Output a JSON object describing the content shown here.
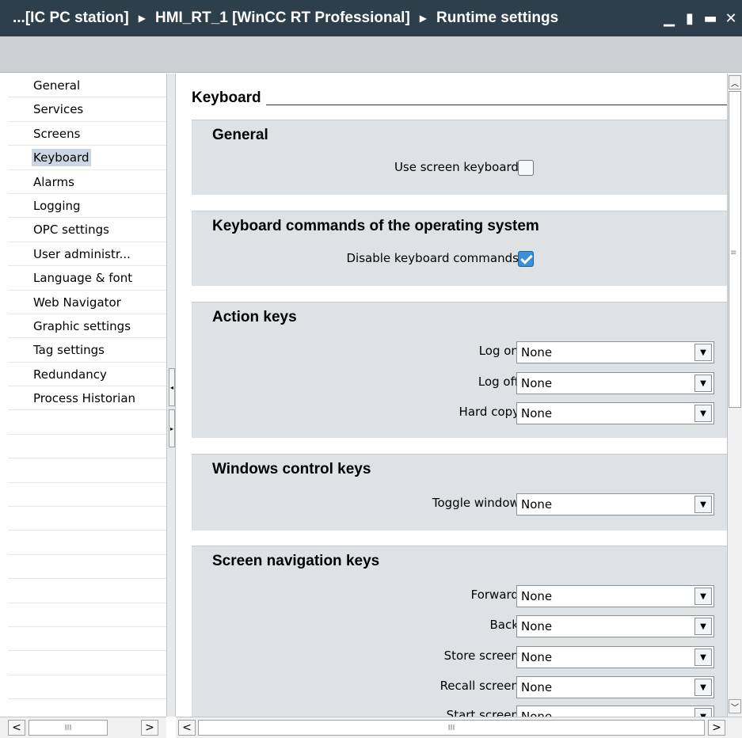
{
  "title_bar": {
    "crumbs": [
      "...[IC PC station]",
      "HMI_RT_1 [WinCC RT Professional]",
      "Runtime settings"
    ],
    "separator": "▶",
    "controls": {
      "minimize": "▁",
      "restore": "▮",
      "maximize": "▬",
      "close": "✕"
    }
  },
  "nav": {
    "items": [
      {
        "label": "General"
      },
      {
        "label": "Services"
      },
      {
        "label": "Screens"
      },
      {
        "label": "Keyboard",
        "selected": true
      },
      {
        "label": "Alarms"
      },
      {
        "label": "Logging"
      },
      {
        "label": "OPC settings"
      },
      {
        "label": "User administr..."
      },
      {
        "label": "Language & font"
      },
      {
        "label": "Web Navigator"
      },
      {
        "label": "Graphic settings"
      },
      {
        "label": "Tag settings"
      },
      {
        "label": "Redundancy"
      },
      {
        "label": "Process Historian"
      }
    ]
  },
  "content": {
    "section_title": "Keyboard",
    "groups": {
      "general": {
        "title": "General",
        "use_screen_keyboard_label": "Use screen keyboard:",
        "use_screen_keyboard_checked": false
      },
      "os_commands": {
        "title": "Keyboard commands of the operating system",
        "disable_label": "Disable keyboard commands:",
        "disable_checked": true
      },
      "action_keys": {
        "title": "Action keys",
        "log_on_label": "Log on:",
        "log_on_value": "None",
        "log_off_label": "Log off:",
        "log_off_value": "None",
        "hard_copy_label": "Hard copy:",
        "hard_copy_value": "None"
      },
      "windows_control": {
        "title": "Windows control keys",
        "toggle_label": "Toggle window:",
        "toggle_value": "None"
      },
      "screen_nav": {
        "title": "Screen navigation keys",
        "forward_label": "Forward:",
        "forward_value": "None",
        "back_label": "Back:",
        "back_value": "None",
        "store_label": "Store screen:",
        "store_value": "None",
        "recall_label": "Recall screen:",
        "recall_value": "None",
        "start_label": "Start screen:",
        "start_value": "None"
      }
    }
  },
  "icons": {
    "dropdown": "▼",
    "scroll_up": "︿",
    "scroll_down": "﹀",
    "scroll_left": "<",
    "scroll_right": ">",
    "grip_h": "III",
    "grip_v": "≡",
    "split_left": "◂",
    "split_right": "▸"
  }
}
